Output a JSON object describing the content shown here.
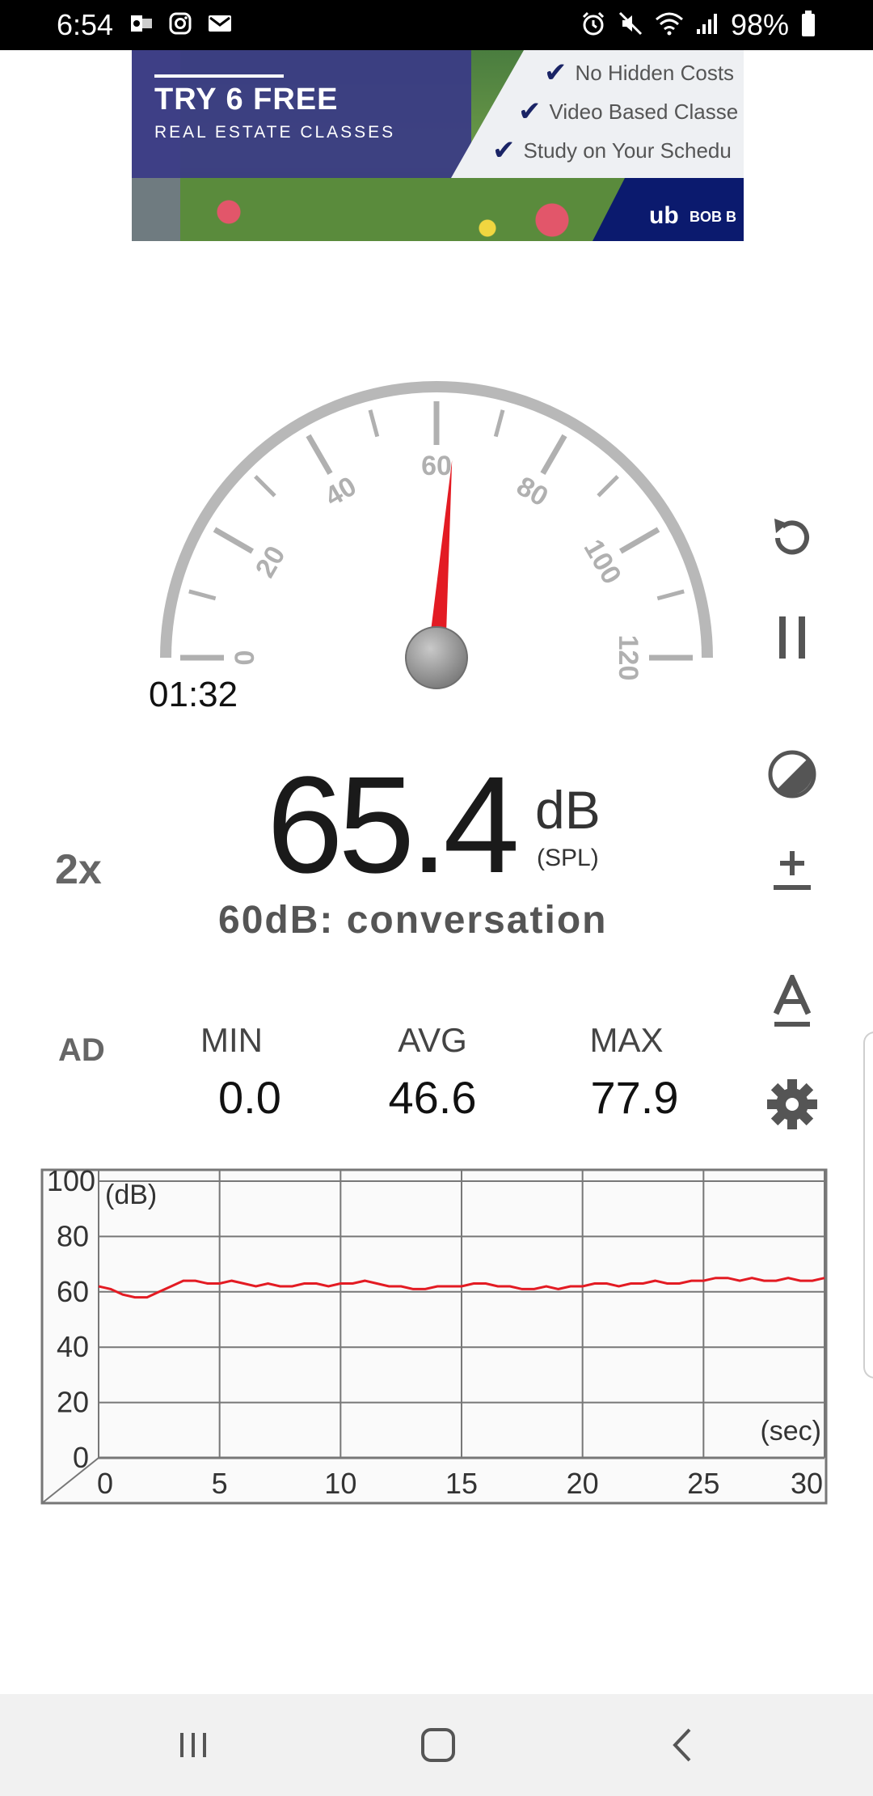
{
  "status_bar": {
    "time": "6:54",
    "battery": "98%",
    "left_icons": [
      "outlook-icon",
      "instagram-icon",
      "gmail-icon"
    ],
    "right_icons": [
      "alarm-icon",
      "mute-icon",
      "wifi-icon",
      "signal-icon",
      "battery-icon"
    ]
  },
  "ad": {
    "title": "TRY 6 FREE",
    "subtitle": "REAL ESTATE CLASSES",
    "checks": [
      "No Hidden Costs",
      "Video Based Classe",
      "Study on Your Schedu"
    ],
    "logo_text": "BOB B"
  },
  "gauge": {
    "scale_labels": [
      "0",
      "20",
      "40",
      "60",
      "80",
      "100",
      "120"
    ],
    "min": 0,
    "max": 120,
    "needle_value": 63,
    "elapsed": "01:32",
    "needle_color": "#e31b23"
  },
  "reading": {
    "value": "65.4",
    "unit": "dB",
    "scale": "(SPL)",
    "description": "60dB: conversation"
  },
  "speed_label": "2x",
  "ad_label": "AD",
  "stats": {
    "min_label": "MIN",
    "min_value": "0.0",
    "avg_label": "AVG",
    "avg_value": "46.6",
    "max_label": "MAX",
    "max_value": "77.9"
  },
  "side_buttons": [
    "reset-icon",
    "pause-icon",
    "contrast-icon",
    "calibrate-plus-minus-icon",
    "font-size-icon",
    "settings-gear-icon"
  ],
  "chart_data": {
    "type": "line",
    "xlabel": "(sec)",
    "ylabel": "(dB)",
    "xlim": [
      0,
      30
    ],
    "ylim": [
      0,
      100
    ],
    "xticks": [
      "0",
      "5",
      "10",
      "15",
      "20",
      "25",
      "30"
    ],
    "yticks": [
      "0",
      "20",
      "40",
      "60",
      "80",
      "100"
    ],
    "grid": true,
    "series": [
      {
        "color": "#e31b23",
        "x": [
          0,
          0.5,
          1,
          1.5,
          2,
          2.5,
          3,
          3.5,
          4,
          4.5,
          5,
          5.5,
          6,
          6.5,
          7,
          7.5,
          8,
          8.5,
          9,
          9.5,
          10,
          10.5,
          11,
          11.5,
          12,
          12.5,
          13,
          13.5,
          14,
          14.5,
          15,
          15.5,
          16,
          16.5,
          17,
          17.5,
          18,
          18.5,
          19,
          19.5,
          20,
          20.5,
          21,
          21.5,
          22,
          22.5,
          23,
          23.5,
          24,
          24.5,
          25,
          25.5,
          26,
          26.5,
          27,
          27.5,
          28,
          28.5,
          29,
          29.5,
          30
        ],
        "y": [
          62,
          61,
          59,
          58,
          58,
          60,
          62,
          64,
          64,
          63,
          63,
          64,
          63,
          62,
          63,
          62,
          62,
          63,
          63,
          62,
          63,
          63,
          64,
          63,
          62,
          62,
          61,
          61,
          62,
          62,
          62,
          63,
          63,
          62,
          62,
          61,
          61,
          62,
          61,
          62,
          62,
          63,
          63,
          62,
          63,
          63,
          64,
          63,
          63,
          64,
          64,
          65,
          65,
          64,
          65,
          64,
          64,
          65,
          64,
          64,
          65
        ]
      }
    ]
  },
  "nav": {
    "buttons": [
      "recents-icon",
      "home-icon",
      "back-icon"
    ]
  },
  "colors": {
    "accent_red": "#e31b23",
    "gauge_gray": "#b8b8b8",
    "nav_bg": "#f1f1f1"
  }
}
